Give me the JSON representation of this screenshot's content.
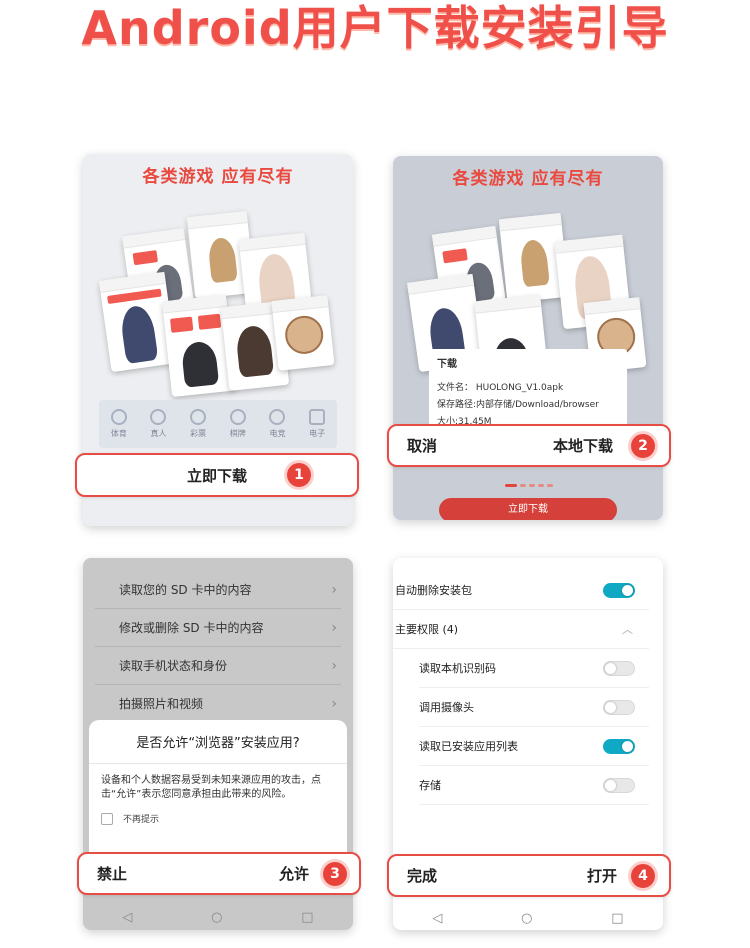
{
  "page": {
    "title": "Android用户下载安装引导"
  },
  "banner": {
    "text": "各类游戏 应有尽有"
  },
  "panel1": {
    "categories": [
      {
        "label": "体育",
        "icon": "trophy-icon"
      },
      {
        "label": "真人",
        "icon": "chip-icon"
      },
      {
        "label": "彩票",
        "icon": "lottery-wheel-icon"
      },
      {
        "label": "棋牌",
        "icon": "cards-icon"
      },
      {
        "label": "电竞",
        "icon": "mouse-icon"
      },
      {
        "label": "电子",
        "icon": "slot-machine-icon"
      }
    ],
    "step": {
      "label": "立即下载",
      "number": "1"
    }
  },
  "panel2": {
    "dialog": {
      "title": "下载",
      "filename": "文件名：  HUOLONG_V1.0apk",
      "path": "保存路径:内部存储/Download/browser",
      "size": "大小:31.45M"
    },
    "step": {
      "cancel": "取消",
      "confirm": "本地下载",
      "number": "2"
    },
    "download_button": "立即下载"
  },
  "panel3": {
    "permissions": [
      "读取您的 SD 卡中的内容",
      "修改或删除 SD 卡中的内容",
      "读取手机状态和身份",
      "拍摄照片和视频"
    ],
    "sheet": {
      "question": "是否允许“浏览器”安装应用?",
      "body": "设备和个人数据容易受到未知来源应用的攻击，点击“允许”表示您同意承担由此带来的风险。",
      "checkbox_label": "不再提示"
    },
    "step": {
      "deny": "禁止",
      "allow": "允许",
      "number": "3"
    }
  },
  "panel4": {
    "auto_delete": {
      "label": "自动删除安装包",
      "on": true
    },
    "main_permissions": "主要权限 (4)",
    "permissions": [
      {
        "label": "读取本机识别码",
        "on": false
      },
      {
        "label": "调用摄像头",
        "on": false
      },
      {
        "label": "读取已安装应用列表",
        "on": true
      },
      {
        "label": "存储",
        "on": false
      }
    ],
    "step": {
      "done": "完成",
      "open": "打开",
      "number": "4"
    }
  },
  "nav": {
    "back": "◁",
    "home": "○",
    "recent": "□"
  }
}
